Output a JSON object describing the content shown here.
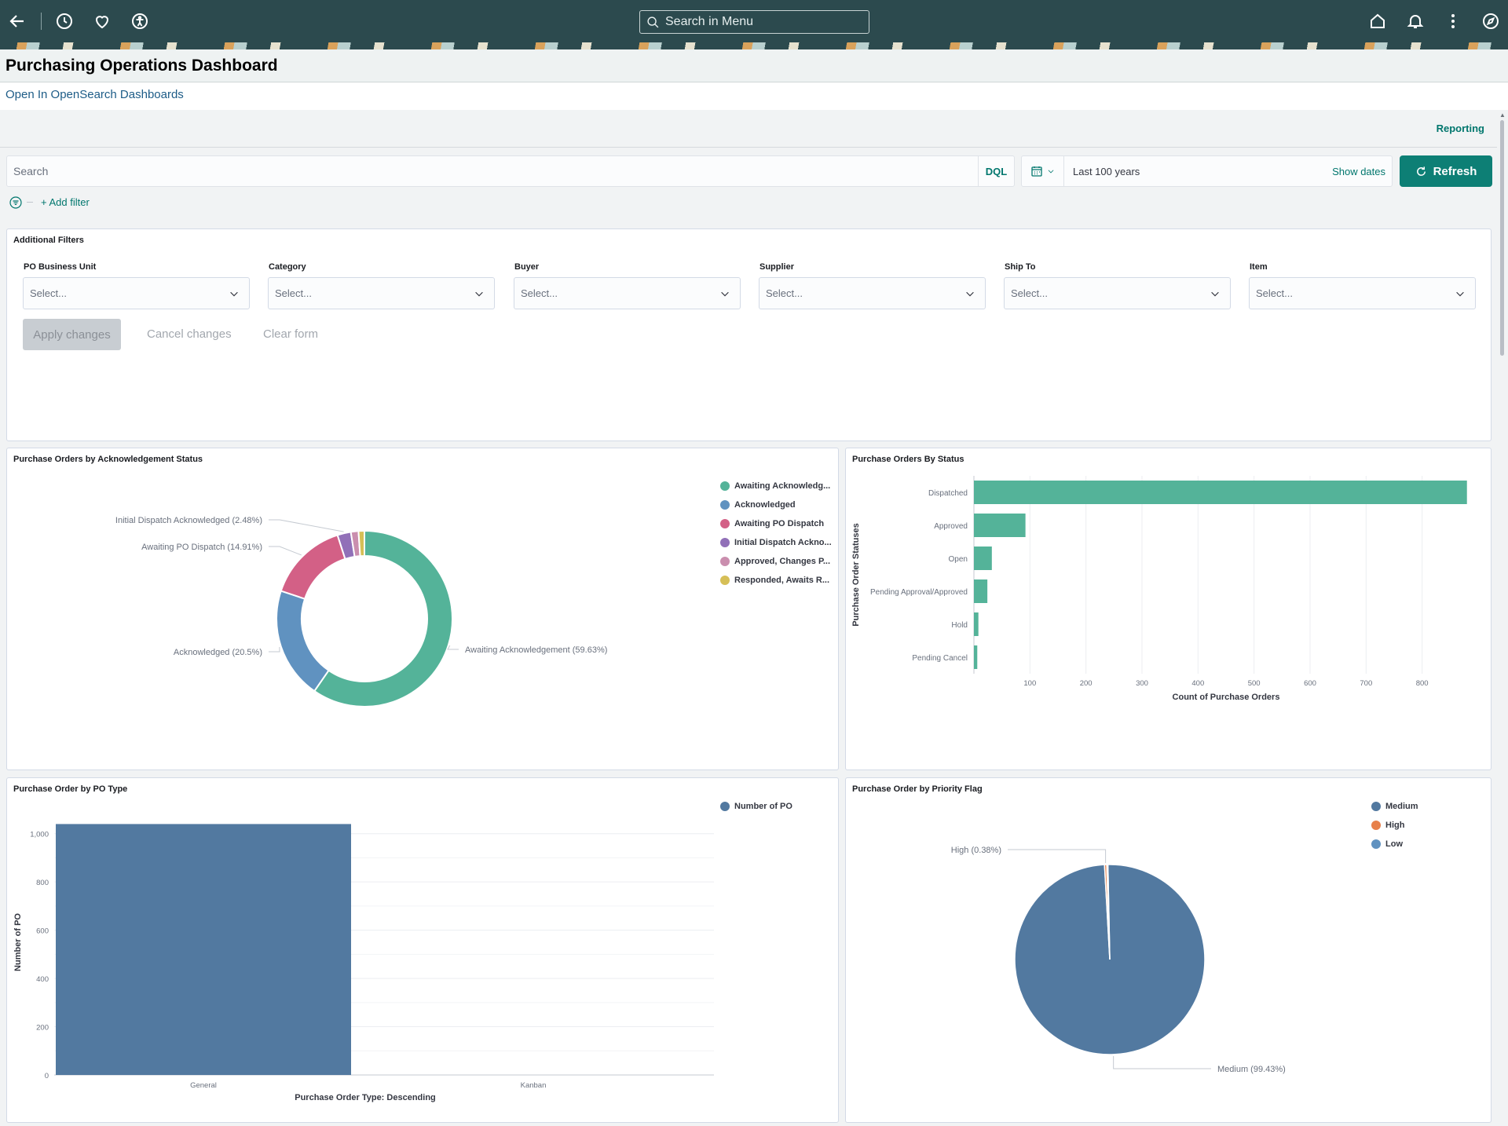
{
  "topbar": {
    "menu_search_placeholder": "Search in Menu",
    "icons": [
      "back-icon",
      "history-icon",
      "favorite-icon",
      "accessibility-icon",
      "home-icon",
      "notification-icon",
      "more-icon",
      "navigator-icon"
    ]
  },
  "page": {
    "title": "Purchasing Operations Dashboard",
    "open_link": "Open In OpenSearch Dashboards"
  },
  "dashboard": {
    "reporting": "Reporting",
    "search_placeholder": "Search",
    "dql": "DQL",
    "date_range": "Last 100 years",
    "show_dates": "Show dates",
    "refresh": "Refresh",
    "add_filter": "+ Add filter",
    "accent_color": "#0d7f75"
  },
  "filters": {
    "title": "Additional Filters",
    "fields": [
      {
        "label": "PO Business Unit",
        "placeholder": "Select..."
      },
      {
        "label": "Category",
        "placeholder": "Select..."
      },
      {
        "label": "Buyer",
        "placeholder": "Select..."
      },
      {
        "label": "Supplier",
        "placeholder": "Select..."
      },
      {
        "label": "Ship To",
        "placeholder": "Select..."
      },
      {
        "label": "Item",
        "placeholder": "Select..."
      }
    ],
    "apply": "Apply changes",
    "cancel": "Cancel changes",
    "clear": "Clear form"
  },
  "chart_data": [
    {
      "type": "pie",
      "donut": true,
      "title": "Purchase Orders by Acknowledgement Status",
      "legend_position": "right",
      "slices": [
        {
          "legend": "Awaiting Acknowledg...",
          "label": "Awaiting Acknowledgement (59.63%)",
          "value": 59.63,
          "color": "#54b399"
        },
        {
          "legend": "Acknowledged",
          "label": "Acknowledged (20.5%)",
          "value": 20.5,
          "color": "#6092c0"
        },
        {
          "legend": "Awaiting PO Dispatch",
          "label": "Awaiting PO Dispatch (14.91%)",
          "value": 14.91,
          "color": "#d36086"
        },
        {
          "legend": "Initial Dispatch Ackno...",
          "label": "Initial Dispatch Acknowledged (2.48%)",
          "value": 2.48,
          "color": "#9170b8"
        },
        {
          "legend": "Approved, Changes P...",
          "label": "",
          "value": 1.4,
          "color": "#ca8eae"
        },
        {
          "legend": "Responded, Awaits R...",
          "label": "",
          "value": 1.08,
          "color": "#d6bf57"
        }
      ]
    },
    {
      "type": "bar",
      "orientation": "horizontal",
      "title": "Purchase Orders By Status",
      "xlabel": "Count of Purchase Orders",
      "ylabel": "Purchase Order Statuses",
      "categories": [
        "Dispatched",
        "Approved",
        "Open",
        "Pending Approval/Approved",
        "Hold",
        "Pending Cancel"
      ],
      "values": [
        880,
        92,
        32,
        24,
        8,
        6
      ],
      "xlim": [
        0,
        900
      ],
      "xticks": [
        100,
        200,
        300,
        400,
        500,
        600,
        700,
        800
      ],
      "grid": true,
      "color": "#54b399"
    },
    {
      "type": "bar",
      "title": "Purchase Order by PO Type",
      "xlabel": "Purchase Order Type: Descending",
      "ylabel": "Number of PO",
      "categories": [
        "General",
        "Kanban"
      ],
      "series": [
        {
          "name": "Number of PO",
          "values": [
            1040,
            0
          ]
        }
      ],
      "ylim": [
        0,
        1100
      ],
      "yticks": [
        "0",
        "200",
        "400",
        "600",
        "800",
        "1,000"
      ],
      "grid": true,
      "legend_position": "top-right",
      "color": "#5279a0"
    },
    {
      "type": "pie",
      "title": "Purchase Order by Priority Flag",
      "legend_position": "top-right",
      "slices": [
        {
          "legend": "Medium",
          "label": "Medium (99.43%)",
          "value": 99.43,
          "color": "#5279a0"
        },
        {
          "legend": "High",
          "label": "High (0.38%)",
          "value": 0.38,
          "color": "#e7804a"
        },
        {
          "legend": "Low",
          "label": "",
          "value": 0.19,
          "color": "#6092c0"
        }
      ]
    }
  ]
}
